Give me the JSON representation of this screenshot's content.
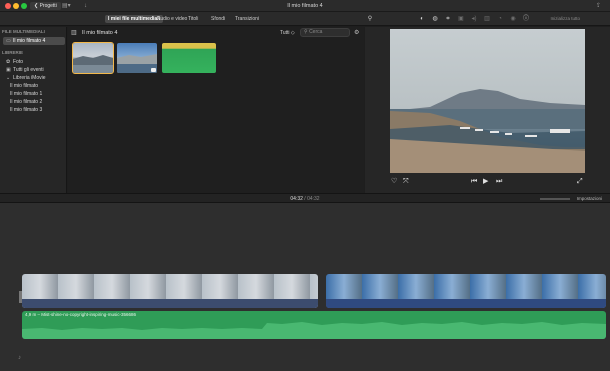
{
  "titlebar": {
    "projects_label": "❮ Progetti",
    "title": "Il mio filmato 4"
  },
  "tabs": {
    "items": [
      {
        "label": "I miei file multimediali",
        "active": true
      },
      {
        "label": "Audio e video",
        "active": false
      },
      {
        "label": "Titoli",
        "active": false
      },
      {
        "label": "Sfondi",
        "active": false
      },
      {
        "label": "Transizioni",
        "active": false
      }
    ],
    "reset_all": "Inizializza tutto"
  },
  "sidebar": {
    "media_heading": "FILE MULTIMEDIALI",
    "project_item": "Il mio filmato 4",
    "libraries_heading": "LIBRERIE",
    "photos": "Foto",
    "all_events": "Tutti gli eventi",
    "library_name": "Libreria iMovie",
    "films": [
      "Il mio filmato",
      "Il mio filmato 1",
      "Il mio filmato 2",
      "Il mio filmato 3"
    ]
  },
  "browser": {
    "title": "Il mio filmato 4",
    "filter_value": "Tutti ◇",
    "search_placeholder": "Cerca"
  },
  "timeline": {
    "current_time": "04:32",
    "total_time": "04:32",
    "settings_label": "Impostazioni",
    "audio_clip_label": "4,9 m – Mist-shine-no-copyright-inspiring-music-356686"
  },
  "colors": {
    "accent": "#f2b84b",
    "audio_track": "#2f9c57",
    "background": "#1e1e1e"
  }
}
